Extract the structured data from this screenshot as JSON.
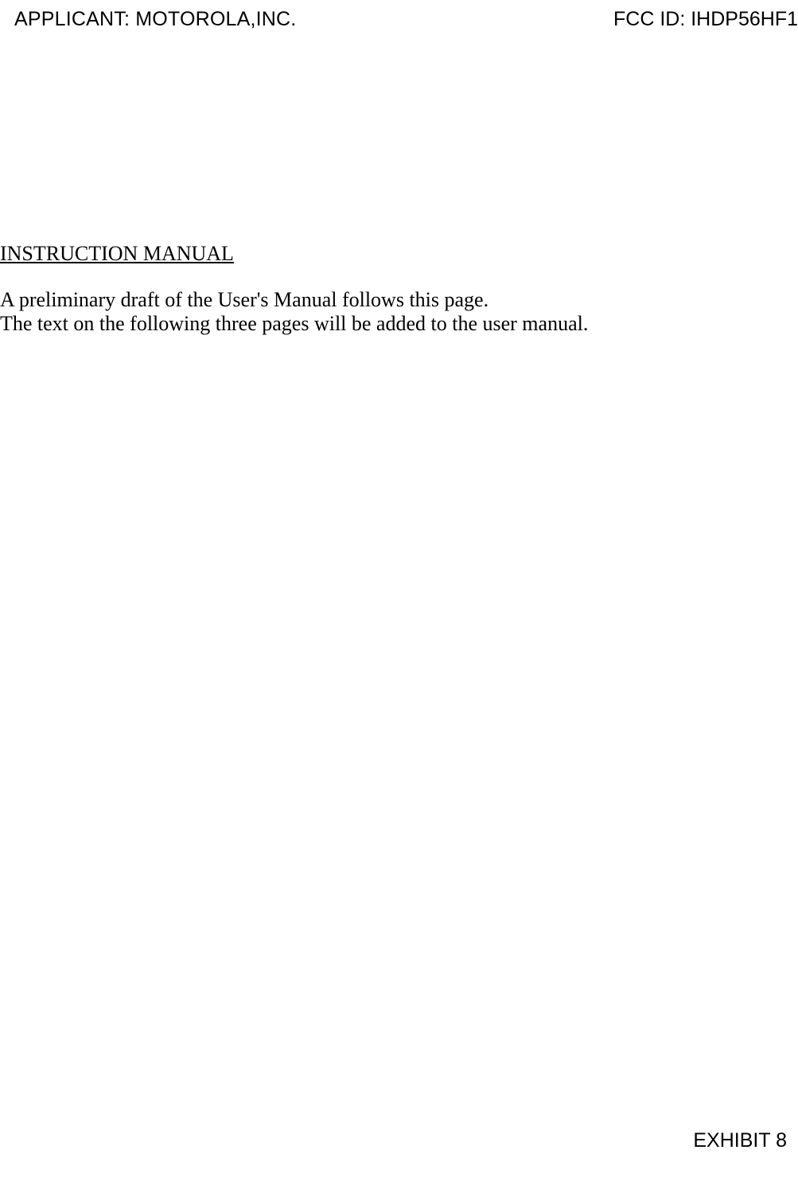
{
  "header": {
    "applicant_label": "APPLICANT: MOTOROLA,INC.",
    "fcc_id_label": "FCC ID: IHDP56HF1"
  },
  "content": {
    "heading": "INSTRUCTION MANUAL",
    "paragraph_line1": "A preliminary draft of the User's Manual follows this page.",
    "paragraph_line2": "The text on the following three pages will be added to the user manual."
  },
  "footer": {
    "exhibit_label": "EXHIBIT 8"
  }
}
